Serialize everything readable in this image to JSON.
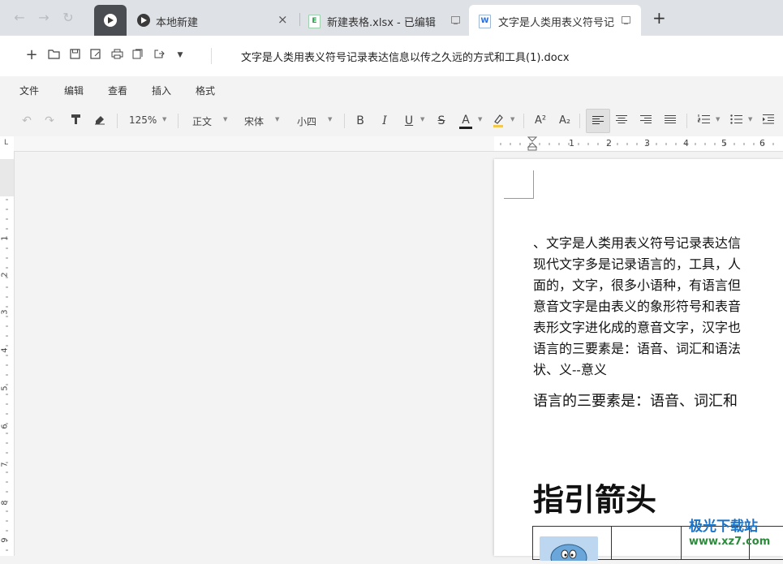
{
  "tabs": [
    {
      "label": "本地新建",
      "close": "×"
    },
    {
      "label": "新建表格.xlsx - 已编辑",
      "file_icon": "E"
    },
    {
      "label": "文字是人类用表义符号记",
      "file_icon": "W"
    }
  ],
  "new_tab": "+",
  "document_title": "文字是人类用表义符号记录表达信息以传之久远的方式和工具(1).docx",
  "menu": [
    "文件",
    "编辑",
    "查看",
    "插入",
    "格式"
  ],
  "format_toolbar": {
    "zoom": "125%",
    "style": "正文",
    "font": "宋体",
    "size": "小四",
    "bold": "B",
    "italic": "I",
    "underline": "U",
    "strike": "S",
    "font_color": "A",
    "superscript": "A²",
    "subscript": "A₂"
  },
  "ruler_h_numbers": [
    "1",
    "2",
    "3",
    "4",
    "5",
    "6"
  ],
  "ruler_v_numbers": [
    "1",
    "2",
    "3",
    "4",
    "5",
    "6",
    "7",
    "8",
    "9"
  ],
  "corner_label": "L",
  "document": {
    "paragraph_lines": [
      "、文字是人类用表义符号记录表达信",
      "现代文字多是记录语言的，工具，人",
      "面的，文字，很多小语种，有语言但",
      "意音文字是由表义的象形符号和表音",
      "表形文字进化成的意音文字，汉字也",
      "语言的三要素是：语音、词汇和语法",
      "状、义--意义"
    ],
    "paragraph2": "语言的三要素是：语音、词汇和",
    "heading": "指引箭头"
  },
  "watermark": {
    "title": "极光下载站",
    "url": "www.xz7.com"
  }
}
